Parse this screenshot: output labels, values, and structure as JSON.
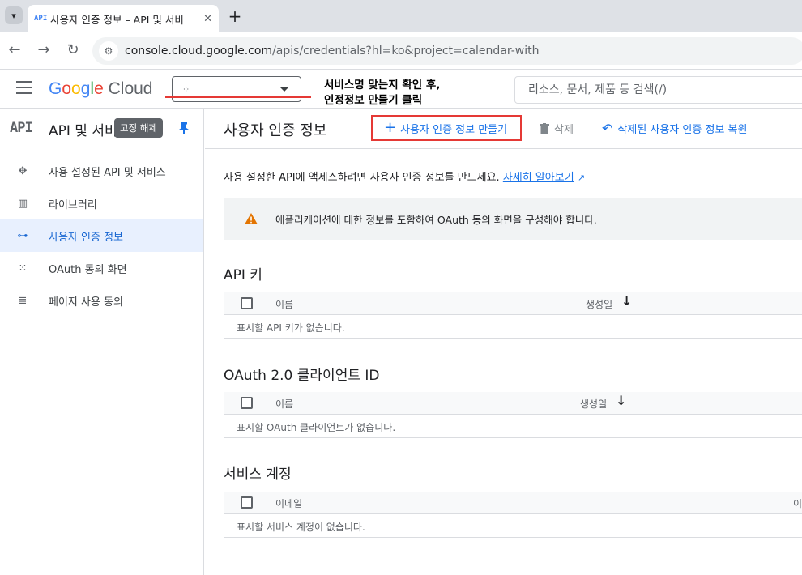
{
  "browser": {
    "tab_title": "사용자 인증 정보 – API 및 서비",
    "tab_favicon": "API",
    "url_host": "console.cloud.google.com",
    "url_rest": "/apis/credentials?hl=ko&project=calendar-with"
  },
  "header": {
    "logo_google": "Google",
    "logo_cloud": "Cloud",
    "annotation_line1": "서비스명 맞는지 확인 후,",
    "annotation_line2": "인정정보 만들기 클릭",
    "search_placeholder": "리소스, 문서, 제품 등 검색(/)"
  },
  "sidebar": {
    "api_mark": "API",
    "title": "API 및 서비스",
    "tooltip": "고정 해제",
    "items": [
      {
        "label": "사용 설정된 API 및 서비스",
        "icon": "api-diamond-icon"
      },
      {
        "label": "라이브러리",
        "icon": "library-icon"
      },
      {
        "label": "사용자 인증 정보",
        "icon": "key-icon",
        "active": true
      },
      {
        "label": "OAuth 동의 화면",
        "icon": "consent-icon"
      },
      {
        "label": "페이지 사용 동의",
        "icon": "settings-list-icon"
      }
    ]
  },
  "main": {
    "title": "사용자 인증 정보",
    "create_label": "사용자 인증 정보 만들기",
    "delete_label": "삭제",
    "restore_label": "삭제된 사용자 인증 정보 복원",
    "intro_text": "사용 설정한 API에 액세스하려면 사용자 인증 정보를 만드세요.",
    "intro_link": "자세히 알아보기",
    "warning_text": "애플리케이션에 대한 정보를 포함하여 OAuth 동의 화면을 구성해야 합니다.",
    "api_keys": {
      "title": "API 키",
      "col_name": "이름",
      "col_created": "생성일",
      "empty": "표시할 API 키가 없습니다."
    },
    "oauth": {
      "title": "OAuth 2.0 클라이언트 ID",
      "col_name": "이름",
      "col_created": "생성일",
      "empty": "표시할 OAuth 클라이언트가 없습니다."
    },
    "service_accounts": {
      "title": "서비스 계정",
      "col_email": "이메일",
      "col_trunc": "이",
      "empty": "표시할 서비스 계정이 없습니다."
    }
  },
  "colors": {
    "accent": "#1a73e8",
    "highlight_red": "#e53935",
    "active_bg": "#e8f0fe"
  }
}
